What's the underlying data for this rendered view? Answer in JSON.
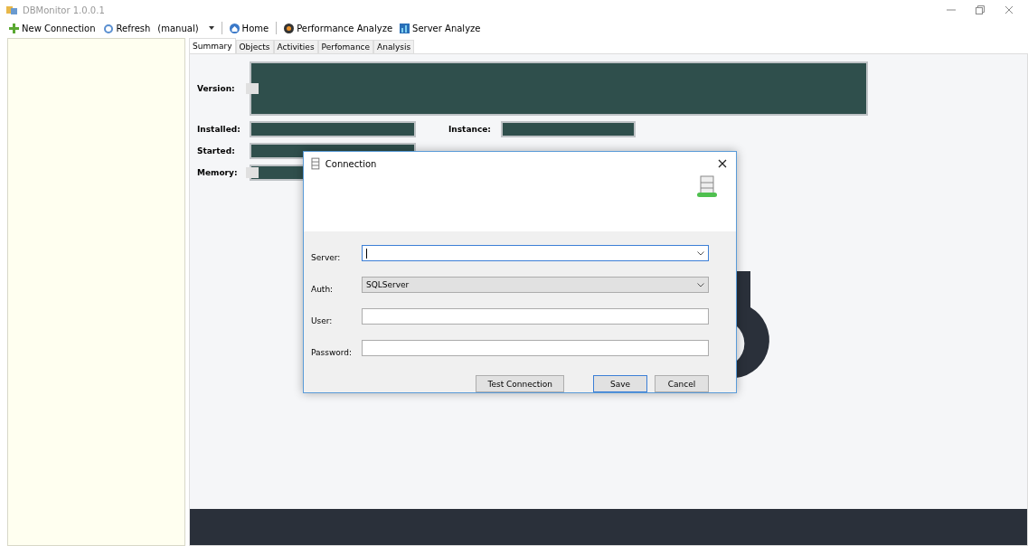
{
  "window": {
    "title": "DBMonitor 1.0.0.1"
  },
  "toolbar": {
    "new_connection": "New Connection",
    "refresh": "Refresh",
    "refresh_mode": "(manual)",
    "home": "Home",
    "performance_analyze": "Performance Analyze",
    "server_analyze": "Server Analyze"
  },
  "tabs": [
    {
      "label": "Summary",
      "selected": true
    },
    {
      "label": "Objects",
      "selected": false
    },
    {
      "label": "Activities",
      "selected": false
    },
    {
      "label": "Perfomance",
      "selected": false
    },
    {
      "label": "Analysis",
      "selected": false
    }
  ],
  "summary": {
    "version_label": "Version:",
    "installed_label": "Installed:",
    "instance_label": "Instance:",
    "started_label": "Started:",
    "memory_label": "Memory:"
  },
  "dialog": {
    "title": "Connection",
    "fields": [
      {
        "label": "Server:",
        "kind": "combo",
        "focused": true
      },
      {
        "label": "Auth:",
        "kind": "select",
        "value": "SQLServer",
        "focused": false
      },
      {
        "label": "User:",
        "kind": "text",
        "focused": false
      },
      {
        "label": "Password:",
        "kind": "text",
        "focused": false
      }
    ],
    "buttons": [
      {
        "label": "Test Connection",
        "default": false
      },
      {
        "label": "Save",
        "default": true
      },
      {
        "label": "Cancel",
        "default": false
      }
    ]
  }
}
